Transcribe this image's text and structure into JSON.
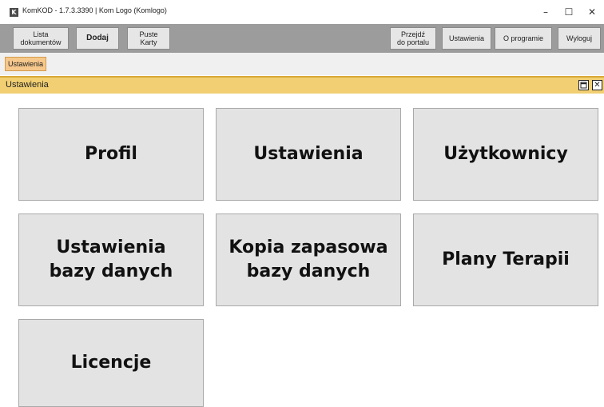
{
  "window": {
    "app_icon_letter": "K",
    "title": "KomKOD - 1.7.3.3390 | Kom Logo (Komlogo)",
    "minimize": "–",
    "maximize": "☐",
    "close": "✕"
  },
  "toolbar": {
    "lista_dokumentow": "Lista\ndokumentów",
    "dodaj": "Dodaj",
    "puste_karty": "Puste\nKarty",
    "przejdz_do_portalu": "Przejdź\ndo portalu",
    "ustawienia": "Ustawienia",
    "o_programie": "O programie",
    "wyloguj": "Wyloguj"
  },
  "tabs": [
    {
      "label": "Ustawienia"
    }
  ],
  "panel": {
    "title": "Ustawienia",
    "restore_icon": "🗖",
    "close_icon": "✕"
  },
  "tiles": [
    {
      "label": "Profil"
    },
    {
      "label": "Ustawienia"
    },
    {
      "label": "Użytkownicy"
    },
    {
      "label": "Ustawienia\nbazy danych"
    },
    {
      "label": "Kopia zapasowa\nbazy danych"
    },
    {
      "label": "Plany Terapii"
    },
    {
      "label": "Licencje"
    }
  ]
}
